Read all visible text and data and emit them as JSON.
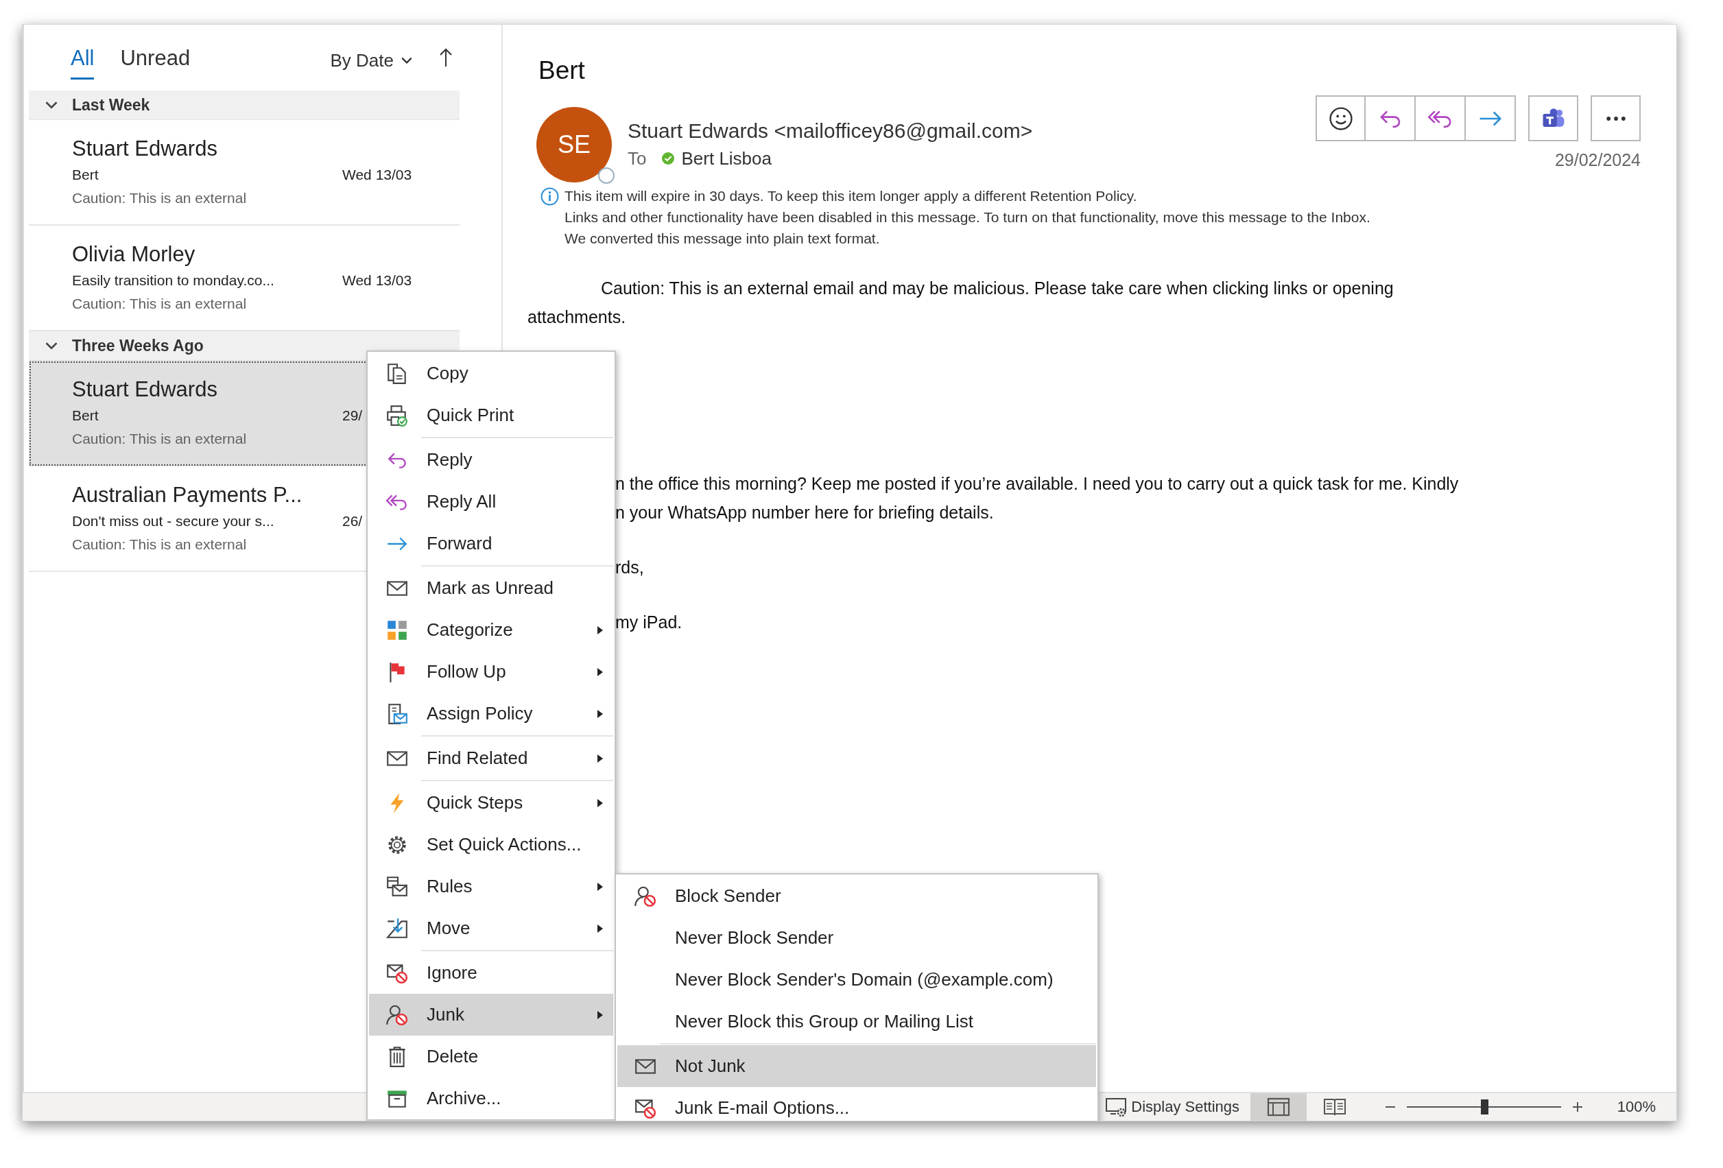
{
  "list_tabs": [
    {
      "label": "All",
      "selected": true
    },
    {
      "label": "Unread",
      "selected": false
    }
  ],
  "sort": {
    "label": "By Date"
  },
  "groups": [
    {
      "title": "Last Week",
      "expanded": true,
      "messages": [
        {
          "sender": "Stuart Edwards",
          "subject": "Bert",
          "date": "Wed 13/03",
          "preview": "Caution: This is an external",
          "selected": false
        },
        {
          "sender": "Olivia Morley",
          "subject": "Easily transition to monday.co...",
          "date": "Wed 13/03",
          "preview": "Caution: This is an external",
          "selected": false
        }
      ]
    },
    {
      "title": "Three Weeks Ago",
      "expanded": true,
      "messages": [
        {
          "sender": "Stuart Edwards",
          "subject": "Bert",
          "date": "29/",
          "preview": "Caution: This is an external",
          "selected": true
        },
        {
          "sender": "Australian Payments P...",
          "subject": "Don't miss out - secure your s...",
          "date": "26/",
          "preview": "Caution: This is an external",
          "selected": false
        }
      ]
    }
  ],
  "message": {
    "title": "Bert",
    "avatar_initials": "SE",
    "sender": "Stuart Edwards <mailofficey86@gmail.com>",
    "to_label": "To",
    "recipient": "Bert Lisboa",
    "date": "29/02/2024",
    "info_lines": [
      "This item will expire in 30 days. To keep this item longer apply a different Retention Policy.",
      "Links and other functionality have been disabled in this message. To turn on that functionality, move this message to the Inbox.",
      "We converted this message into plain text format."
    ],
    "caution_lines": [
      "Caution: This is an external email and may be malicious. Please take care when clicking links or opening",
      "attachments."
    ],
    "body_paragraphs": [
      [
        "n the office this morning? Keep me posted if you’re available. I need you to carry out a quick task for me. Kindly",
        "n your WhatsApp number here for briefing details."
      ],
      [
        "rds,"
      ],
      [
        "my iPad."
      ]
    ]
  },
  "context_menu": {
    "items": [
      {
        "label": "Copy",
        "submenu": false,
        "selected": false,
        "separator_after": false
      },
      {
        "label": "Quick Print",
        "submenu": false,
        "selected": false,
        "separator_after": true
      },
      {
        "label": "Reply",
        "submenu": false,
        "selected": false,
        "separator_after": false
      },
      {
        "label": "Reply All",
        "submenu": false,
        "selected": false,
        "separator_after": false
      },
      {
        "label": "Forward",
        "submenu": false,
        "selected": false,
        "separator_after": true
      },
      {
        "label": "Mark as Unread",
        "submenu": false,
        "selected": false,
        "separator_after": false
      },
      {
        "label": "Categorize",
        "submenu": true,
        "selected": false,
        "separator_after": false
      },
      {
        "label": "Follow Up",
        "submenu": true,
        "selected": false,
        "separator_after": false
      },
      {
        "label": "Assign Policy",
        "submenu": true,
        "selected": false,
        "separator_after": true
      },
      {
        "label": "Find Related",
        "submenu": true,
        "selected": false,
        "separator_after": true
      },
      {
        "label": "Quick Steps",
        "submenu": true,
        "selected": false,
        "separator_after": false
      },
      {
        "label": "Set Quick Actions...",
        "submenu": false,
        "selected": false,
        "separator_after": false
      },
      {
        "label": "Rules",
        "submenu": true,
        "selected": false,
        "separator_after": false
      },
      {
        "label": "Move",
        "submenu": true,
        "selected": false,
        "separator_after": true
      },
      {
        "label": "Ignore",
        "submenu": false,
        "selected": false,
        "separator_after": false
      },
      {
        "label": "Junk",
        "submenu": true,
        "selected": true,
        "separator_after": false
      },
      {
        "label": "Delete",
        "submenu": false,
        "selected": false,
        "separator_after": false
      },
      {
        "label": "Archive...",
        "submenu": false,
        "selected": false,
        "separator_after": false
      }
    ]
  },
  "junk_submenu": {
    "items": [
      {
        "label": "Block Sender",
        "selected": false,
        "separator_after": false
      },
      {
        "label": "Never Block Sender",
        "selected": false,
        "separator_after": false
      },
      {
        "label": "Never Block Sender's Domain (@example.com)",
        "selected": false,
        "separator_after": false
      },
      {
        "label": "Never Block this Group or Mailing List",
        "selected": false,
        "separator_after": true
      },
      {
        "label": "Not Junk",
        "selected": true,
        "separator_after": false
      },
      {
        "label": "Junk E-mail Options...",
        "selected": false,
        "separator_after": false
      }
    ]
  },
  "status_bar": {
    "display_settings": "Display Settings",
    "views": [
      {
        "selected": true
      },
      {
        "selected": false
      }
    ],
    "zoom": {
      "level": 0.5,
      "reading": "100%"
    }
  }
}
